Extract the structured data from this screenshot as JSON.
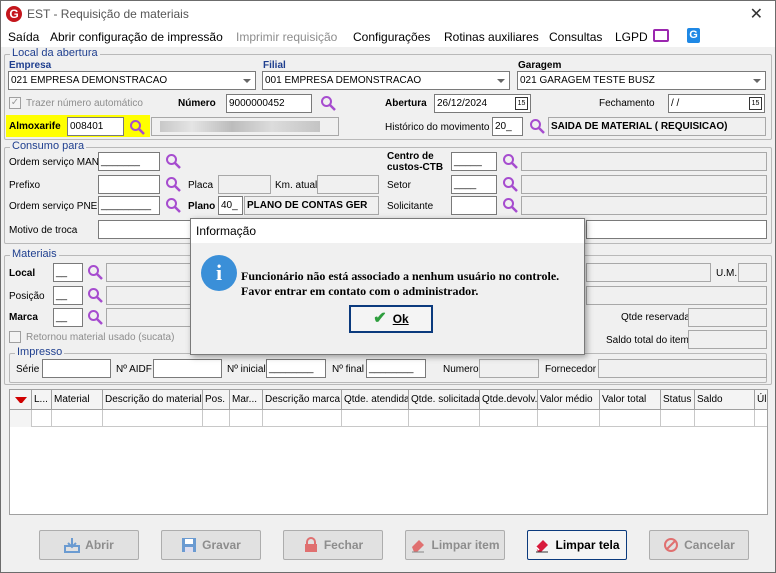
{
  "window": {
    "title": "EST - Requisição de materiais",
    "close": "✕",
    "logo": "G"
  },
  "menu": {
    "saida": "Saída",
    "abrir_config": "Abrir configuração de impressão",
    "imprimir": "Imprimir requisição",
    "configuracoes": "Configurações",
    "rotinas": "Rotinas auxiliares",
    "consultas": "Consultas",
    "lgpd": "LGPD"
  },
  "local": {
    "legend": "Local da abertura",
    "empresa_label": "Empresa",
    "empresa_value": "021 EMPRESA DEMONSTRACAO",
    "filial_label": "Filial",
    "filial_value": "001 EMPRESA DEMONSTRACAO",
    "garagem_label": "Garagem",
    "garagem_value": "021 GARAGEM TESTE BUSZ",
    "trazer_label": "Trazer número automático",
    "numero_label": "Número",
    "numero_value": "9000000452",
    "abertura_label": "Abertura",
    "abertura_value": "26/12/2024",
    "fechamento_label": "Fechamento",
    "fechamento_value": "/ /",
    "almoxarife_label": "Almoxarife",
    "almoxarife_value": "008401",
    "historico_label": "Histórico do movimento",
    "historico_value": "20_",
    "historico_desc": "SAIDA DE MATERIAL ( REQUISICAO)",
    "calendar_icon": "15"
  },
  "consumo": {
    "legend": "Consumo para",
    "os_man_label": "Ordem serviço MAN",
    "os_man_value": "_______",
    "prefixo_label": "Prefixo",
    "placa_label": "Placa",
    "km_label": "Km. atual",
    "os_pne_label": "Ordem serviço PNE",
    "os_pne_value": "_________",
    "plano_label": "Plano",
    "plano_value": "40_",
    "plano_desc": "PLANO DE CONTAS GER",
    "motivo_label": "Motivo de troca",
    "centro_label": "Centro de custos-CTB",
    "centro_value": "_____",
    "setor_label": "Setor",
    "setor_value": "____",
    "solicitante_label": "Solicitante"
  },
  "materiais": {
    "legend": "Materiais",
    "local_label": "Local",
    "local_value": "__",
    "posicao_label": "Posição",
    "posicao_value": "__",
    "marca_label": "Marca",
    "marca_value": "__",
    "retornou_label": "Retornou material usado (sucata)",
    "um_label": "U.M.",
    "qtde_reservada_label": "Qtde reservada",
    "saldo_total_label": "Saldo total do item",
    "impresso_legend": "Impresso",
    "serie_label": "Série",
    "aidf_label": "Nº AIDF",
    "inicial_label": "Nº inicial",
    "inicial_value": "________",
    "final_label": "Nº final",
    "final_value": "________",
    "numero_label": "Numero",
    "fornecedor_label": "Fornecedor"
  },
  "grid": {
    "columns": [
      "L...",
      "Material",
      "Descrição do material",
      "Pos.",
      "Mar...",
      "Descrição marca",
      "Qtde. atendida",
      "Qtde. solicitada",
      "Qtde.devolv.",
      "Valor médio",
      "Valor total",
      "Status",
      "Saldo",
      "Úl"
    ]
  },
  "buttons": {
    "abrir": "Abrir",
    "gravar": "Gravar",
    "fechar": "Fechar",
    "limpar_item": "Limpar item",
    "limpar_tela": "Limpar tela",
    "cancelar": "Cancelar"
  },
  "dialog": {
    "title": "Informação",
    "line1": "Funcionário não está associado a nenhum usuário no controle.",
    "line2": "Favor entrar em contato com o administrador.",
    "ok": "Ok",
    "icon": "i"
  },
  "colors": {
    "accent": "#1f3f8f",
    "highlight": "#ffff00",
    "magnifier": "#a64ccf",
    "info": "#3a8fd8"
  }
}
